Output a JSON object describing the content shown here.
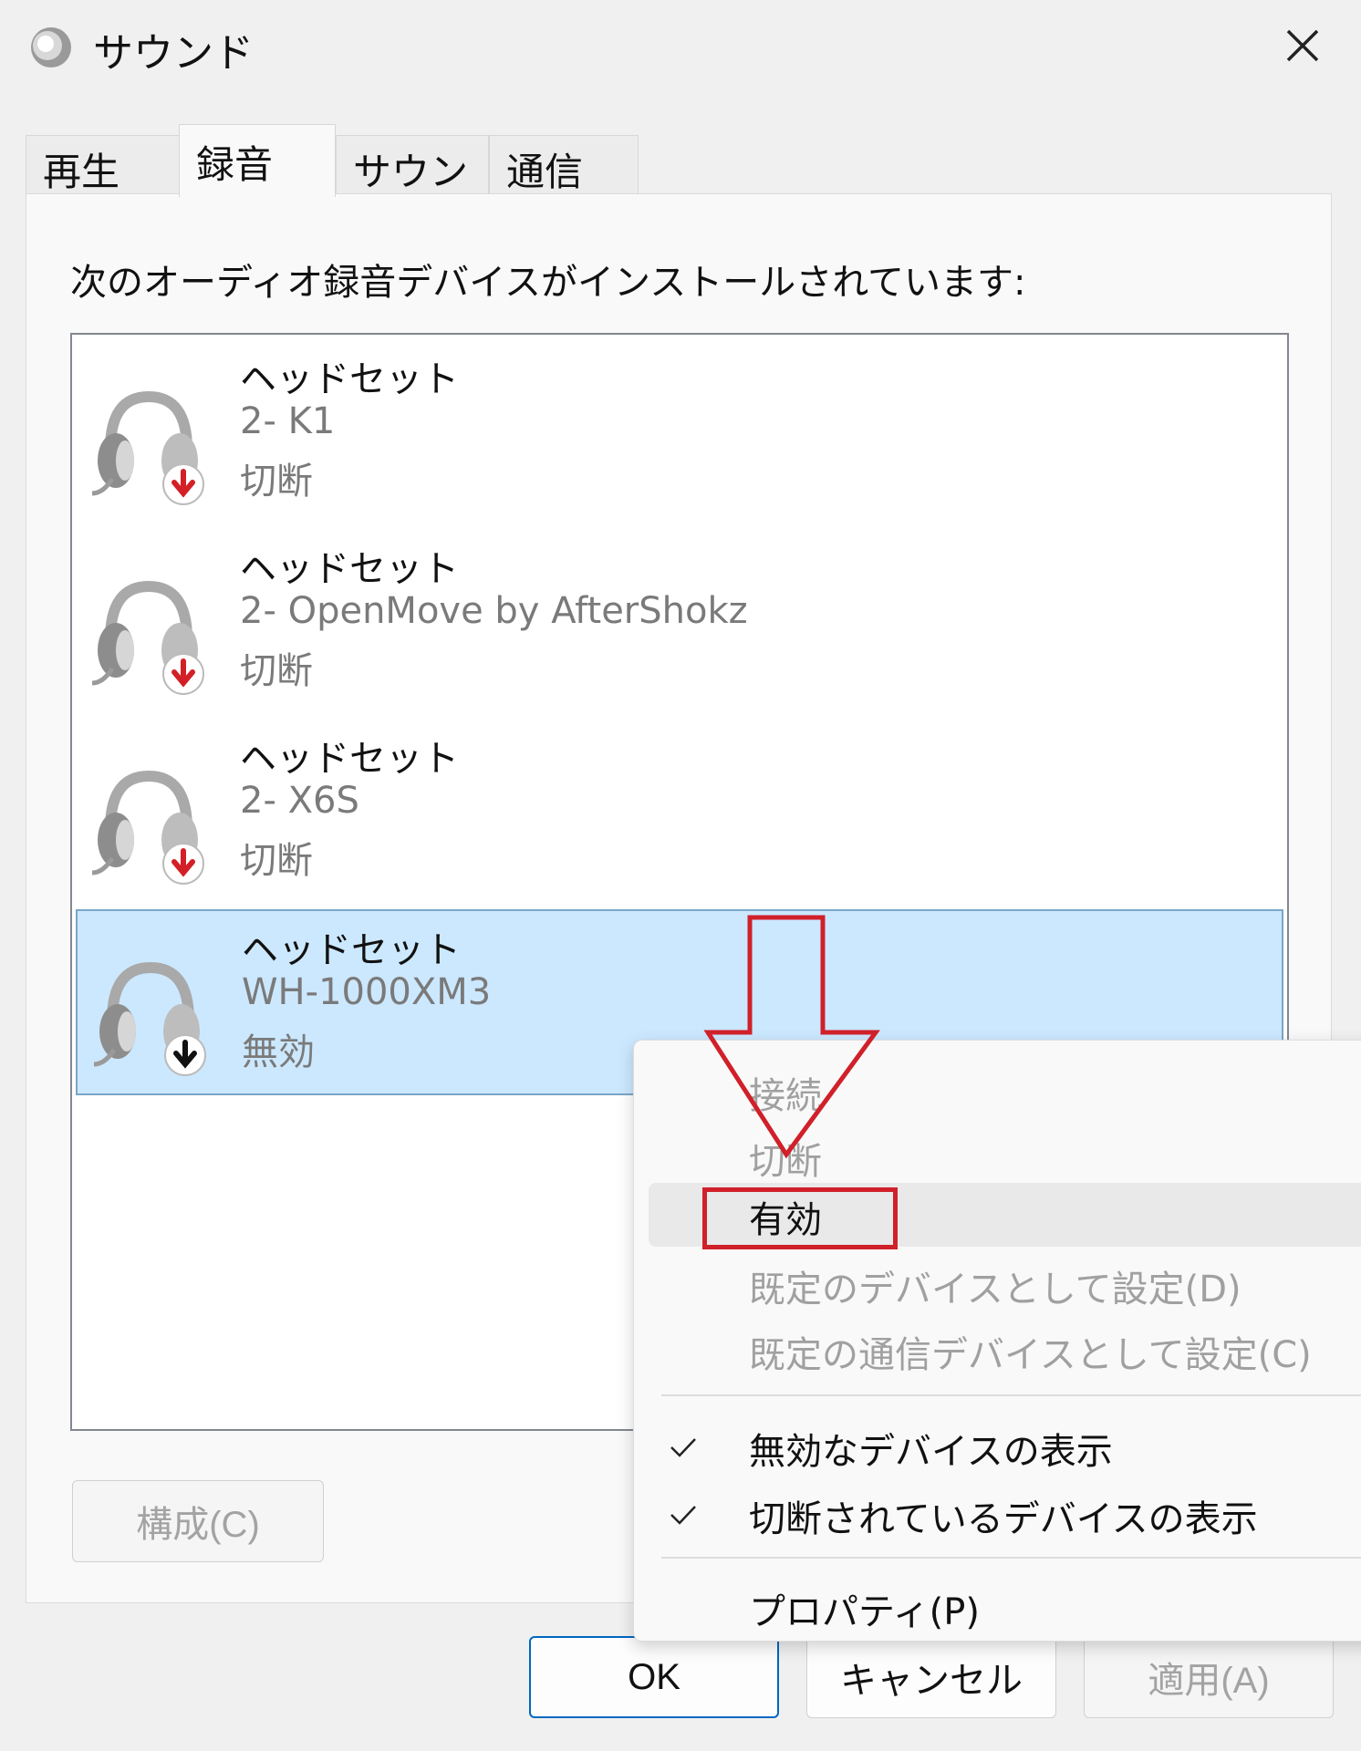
{
  "window": {
    "title": "サウンド"
  },
  "tabs": [
    {
      "label": "再生"
    },
    {
      "label": "録音"
    },
    {
      "label": "サウンド"
    },
    {
      "label": "通信"
    }
  ],
  "panel": {
    "label": "次のオーディオ録音デバイスがインストールされています:"
  },
  "devices": [
    {
      "name": "ヘッドセット",
      "model": "2- K1",
      "status": "切断",
      "badge_color": "#d32027"
    },
    {
      "name": "ヘッドセット",
      "model": "2- OpenMove by AfterShokz",
      "status": "切断",
      "badge_color": "#d32027"
    },
    {
      "name": "ヘッドセット",
      "model": "2- X6S",
      "status": "切断",
      "badge_color": "#d32027"
    },
    {
      "name": "ヘッドセット",
      "model": "WH-1000XM3",
      "status": "無効",
      "badge_color": "#111111",
      "selected": true
    }
  ],
  "buttons": {
    "configure": "構成(C)",
    "ok": "OK",
    "cancel": "キャンセル",
    "apply": "適用(A)"
  },
  "context_menu": {
    "connect": "接続",
    "disconnect": "切断",
    "enable": "有効",
    "set_default": "既定のデバイスとして設定(D)",
    "set_default_comm": "既定の通信デバイスとして設定(C)",
    "show_disabled": "無効なデバイスの表示",
    "show_disconnected": "切断されているデバイスの表示",
    "properties": "プロパティ(P)",
    "check_mark": "✓"
  },
  "icons": {
    "app": "speaker-icon",
    "close": "close-icon",
    "device": "headset-icon",
    "badge": "down-arrow-badge-icon"
  },
  "colors": {
    "selection": "#cce8ff",
    "annotation": "#d0202a",
    "accent": "#0067c0"
  }
}
